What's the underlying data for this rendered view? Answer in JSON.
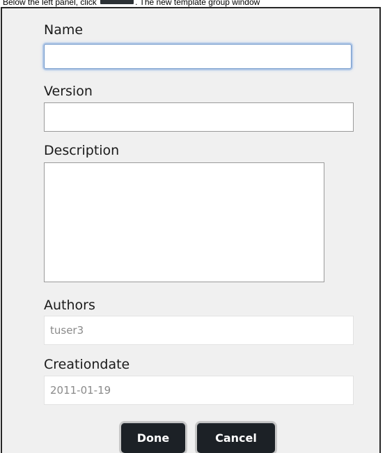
{
  "instruction": {
    "text_before": "Below the left panel, click",
    "text_after": ". The new template group window"
  },
  "form": {
    "name": {
      "label": "Name",
      "value": ""
    },
    "version": {
      "label": "Version",
      "value": ""
    },
    "description": {
      "label": "Description",
      "value": ""
    },
    "authors": {
      "label": "Authors",
      "value": "tuser3"
    },
    "creationdate": {
      "label": "Creationdate",
      "value": "2011-01-19"
    }
  },
  "buttons": {
    "done": "Done",
    "cancel": "Cancel"
  }
}
